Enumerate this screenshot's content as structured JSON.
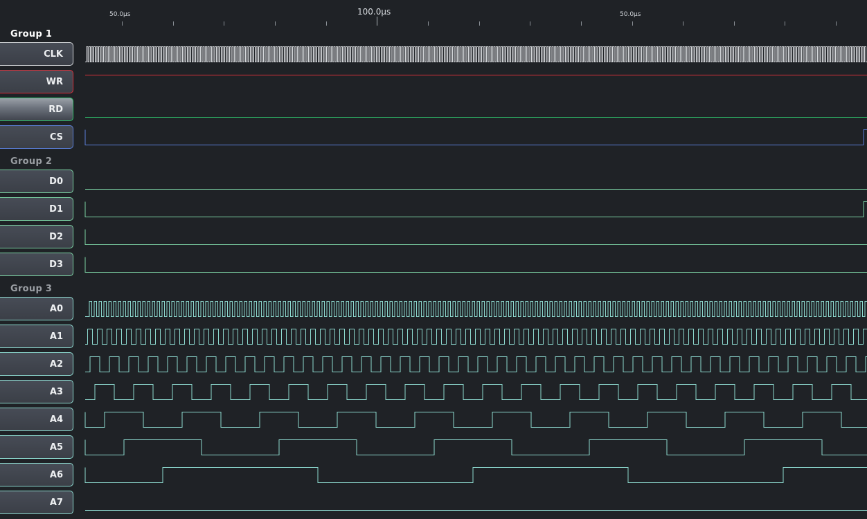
{
  "ruler": {
    "labels": [
      {
        "text": "50.0µs",
        "major": false
      },
      {
        "text": "100.0µs",
        "major": true
      },
      {
        "text": "50.0µs",
        "major": false
      }
    ]
  },
  "groups": [
    {
      "label": "Group 1",
      "color": "#ffffff"
    },
    {
      "label": "Group 2",
      "color": "#9a9ea3"
    },
    {
      "label": "Group 3",
      "color": "#9a9ea3"
    }
  ],
  "channels": [
    {
      "name": "CLK",
      "group": 1,
      "color": "#d4d7da",
      "kind": "clock"
    },
    {
      "name": "WR",
      "group": 1,
      "color": "#d9303a",
      "kind": "high"
    },
    {
      "name": "RD",
      "group": 1,
      "color": "#2fbf6a",
      "kind": "low",
      "selected": true
    },
    {
      "name": "CS",
      "group": 1,
      "color": "#5b7fd8",
      "kind": "low_edges"
    },
    {
      "name": "D0",
      "group": 2,
      "color": "#7bd1a3",
      "kind": "low"
    },
    {
      "name": "D1",
      "group": 2,
      "color": "#7bd1a3",
      "kind": "low_edges"
    },
    {
      "name": "D2",
      "group": 2,
      "color": "#7bd1a3",
      "kind": "low_start"
    },
    {
      "name": "D3",
      "group": 2,
      "color": "#7bd1a3",
      "kind": "low_start"
    },
    {
      "name": "A0",
      "group": 3,
      "color": "#8dd9cf",
      "kind": "square",
      "divider": 1
    },
    {
      "name": "A1",
      "group": 3,
      "color": "#8dd9cf",
      "kind": "square",
      "divider": 2
    },
    {
      "name": "A2",
      "group": 3,
      "color": "#8dd9cf",
      "kind": "square",
      "divider": 4
    },
    {
      "name": "A3",
      "group": 3,
      "color": "#8dd9cf",
      "kind": "square",
      "divider": 8
    },
    {
      "name": "A4",
      "group": 3,
      "color": "#8dd9cf",
      "kind": "square",
      "divider": 16
    },
    {
      "name": "A5",
      "group": 3,
      "color": "#8dd9cf",
      "kind": "square",
      "divider": 32
    },
    {
      "name": "A6",
      "group": 3,
      "color": "#8dd9cf",
      "kind": "square",
      "divider": 64
    },
    {
      "name": "A7",
      "group": 3,
      "color": "#8dd9cf",
      "kind": "low"
    }
  ]
}
